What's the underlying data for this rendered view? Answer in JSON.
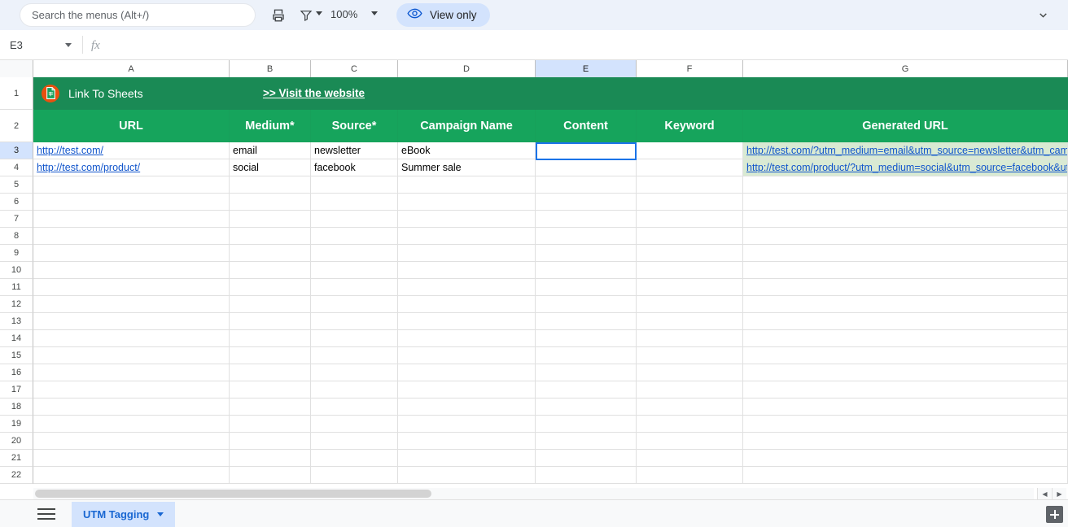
{
  "toolbar": {
    "search_placeholder": "Search the menus (Alt+/)",
    "search_value": "",
    "print_icon": "print-icon",
    "filter_icon": "filter-icon",
    "zoom_level": "100%",
    "view_only_label": "View only",
    "eye_icon": "eye-icon",
    "collapse_icon": "chevron-down-icon"
  },
  "formula_bar": {
    "name_box_value": "E3",
    "fx_label": "fx",
    "formula_value": ""
  },
  "grid": {
    "columns": [
      "A",
      "B",
      "C",
      "D",
      "E",
      "F",
      "G"
    ],
    "selected_column": "E",
    "selected_row": "3",
    "selected_cell": "E3",
    "rows": [
      "1",
      "2",
      "3",
      "4",
      "5",
      "6",
      "7",
      "8",
      "9",
      "10",
      "11",
      "12",
      "13",
      "14",
      "15",
      "16",
      "17",
      "18",
      "19",
      "20",
      "21",
      "22"
    ],
    "banner": {
      "brand_label": "Link To Sheets",
      "brand_icon": "google-sheets-icon",
      "visit_link_label": ">> Visit the website",
      "bg_color": "#1a8a55"
    },
    "headers": {
      "bg_color": "#16a45c",
      "labels": [
        "URL",
        "Medium*",
        "Source*",
        "Campaign Name",
        "Content",
        "Keyword",
        "Generated URL"
      ]
    },
    "data_rows": [
      {
        "row": "3",
        "url": "http://test.com/",
        "medium": "email",
        "source": "newsletter",
        "campaign": "eBook",
        "content": "",
        "keyword": "",
        "generated_url": "http://test.com/?utm_medium=email&utm_source=newsletter&utm_campaign=eBook"
      },
      {
        "row": "4",
        "url": "http://test.com/product/",
        "medium": "social",
        "source": "facebook",
        "campaign": "Summer sale",
        "content": "",
        "keyword": "",
        "generated_url": "http://test.com/product/?utm_medium=social&utm_source=facebook&utm_campaign=Summer sale"
      }
    ],
    "generated_url_bg": "#d9ead3",
    "link_color": "#1155cc",
    "selection_color": "#1a73e8"
  },
  "sheet_bar": {
    "menu_icon": "hamburger-menu-icon",
    "tab_label": "UTM Tagging",
    "tab_caret_icon": "chevron-down-icon",
    "add_sheet_icon": "plus-icon",
    "scroll_left_icon": "arrow-left-icon",
    "scroll_right_icon": "arrow-right-icon"
  }
}
